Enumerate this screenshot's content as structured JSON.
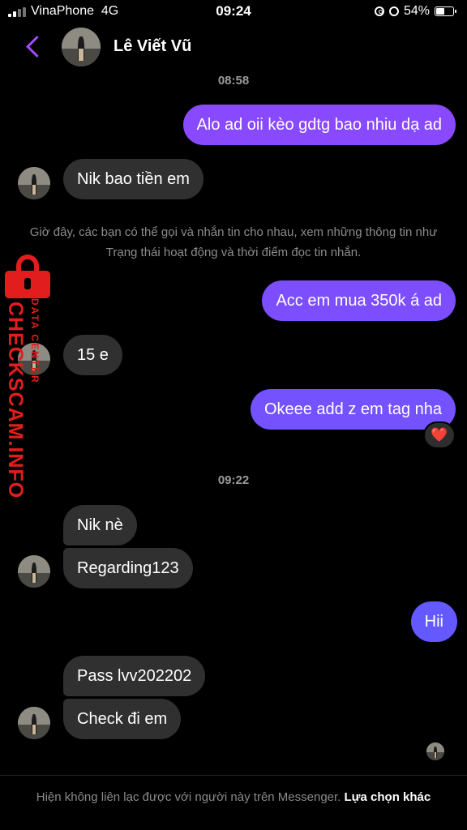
{
  "status_bar": {
    "carrier": "VinaPhone",
    "network": "4G",
    "time": "09:24",
    "battery": "54%",
    "battery_level": 0.54
  },
  "header": {
    "contact_name": "Lê Viết Vũ"
  },
  "conversation": {
    "time_1": "08:58",
    "msg_1": "Alo ad oii kèo gdtg bao nhiu dạ ad",
    "msg_2": "Nik bao tiền em",
    "notice": "Giờ đây, các bạn có thể gọi và nhắn tin cho nhau, xem những thông tin như Trạng thái hoạt động và thời điểm đọc tin nhắn.",
    "msg_3": "Acc em mua 350k á ad",
    "msg_4": "15 e",
    "msg_5": "Okeee add z em tag nha",
    "msg_5_reaction": "❤️",
    "time_2": "09:22",
    "msg_6": "Nik nè",
    "msg_7": "Regarding123",
    "msg_8": "Hii",
    "msg_9": "Pass lvv202202",
    "msg_10": "Check đi em"
  },
  "watermark": {
    "brand": "CHECKSCAM.INFO",
    "sub": "DATA CENTER"
  },
  "footer": {
    "text": "Hiện không liên lạc được với người này trên Messenger.",
    "link": "Lựa chọn khác"
  },
  "colors": {
    "accent": "#a64cff",
    "outgoing_top": "#9146ff",
    "outgoing_bottom": "#5a5cff",
    "incoming": "#303030",
    "watermark": "#e21d1d"
  }
}
